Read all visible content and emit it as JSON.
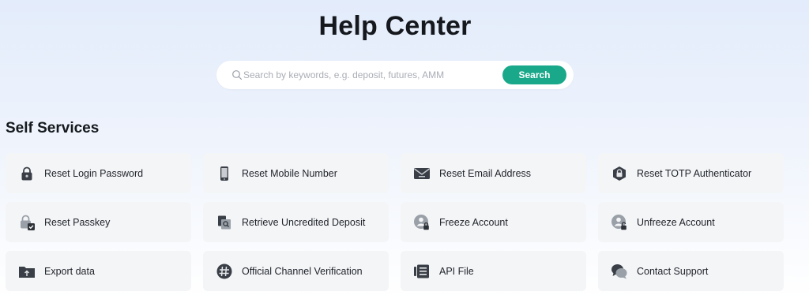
{
  "page": {
    "title": "Help Center"
  },
  "search": {
    "placeholder": "Search by keywords, e.g. deposit, futures, AMM",
    "button_label": "Search",
    "accent_color": "#19a98a"
  },
  "self_services": {
    "title": "Self Services",
    "items": [
      {
        "label": "Reset Login Password",
        "icon": "padlock-icon"
      },
      {
        "label": "Reset Mobile Number",
        "icon": "mobile-phone-icon"
      },
      {
        "label": "Reset Email Address",
        "icon": "envelope-icon"
      },
      {
        "label": "Reset TOTP Authenticator",
        "icon": "shield-lock-icon"
      },
      {
        "label": "Reset Passkey",
        "icon": "lock-check-icon"
      },
      {
        "label": "Retrieve Uncredited Deposit",
        "icon": "document-search-icon"
      },
      {
        "label": "Freeze Account",
        "icon": "user-lock-icon"
      },
      {
        "label": "Unfreeze Account",
        "icon": "user-unlock-icon"
      },
      {
        "label": "Export data",
        "icon": "folder-upload-icon"
      },
      {
        "label": "Official Channel Verification",
        "icon": "hash-badge-icon"
      },
      {
        "label": "API File",
        "icon": "api-file-icon"
      },
      {
        "label": "Contact Support",
        "icon": "chat-bubbles-icon"
      }
    ]
  }
}
